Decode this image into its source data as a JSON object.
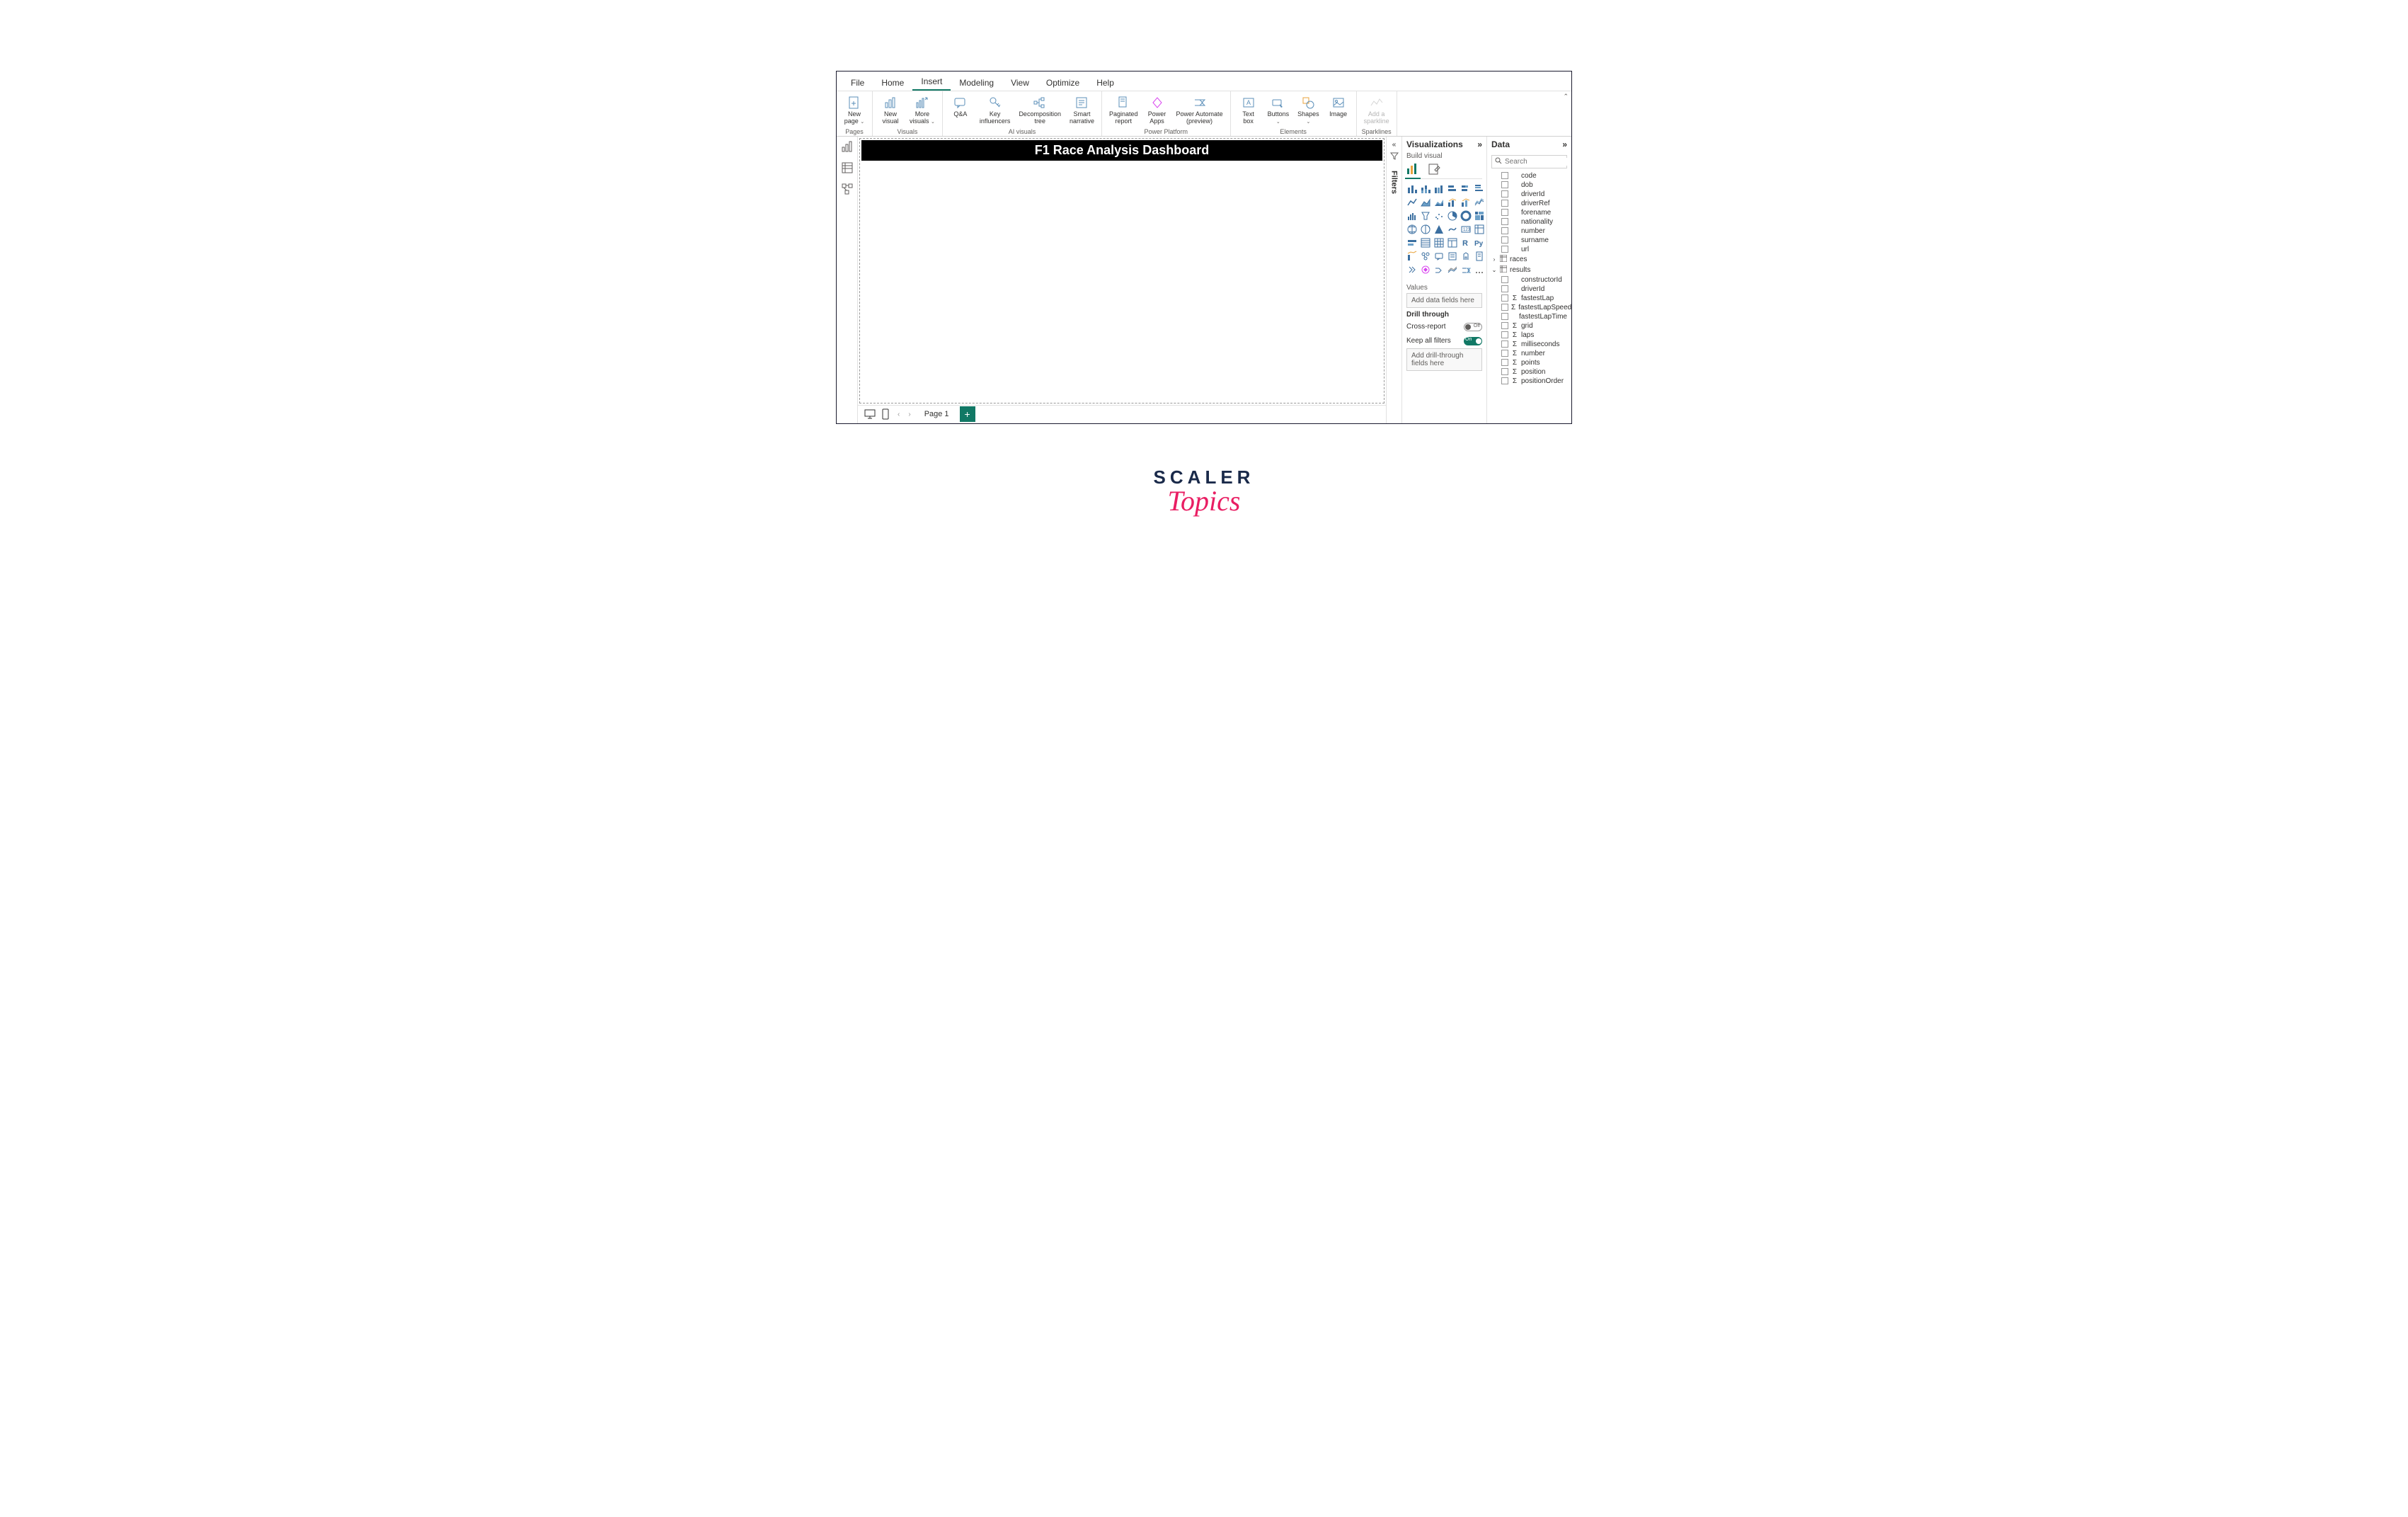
{
  "tabs": [
    "File",
    "Home",
    "Insert",
    "Modeling",
    "View",
    "Optimize",
    "Help"
  ],
  "activeTab": "Insert",
  "ribbon": {
    "pages": {
      "label": "Pages",
      "btns": [
        {
          "l1": "New",
          "l2": "page"
        }
      ]
    },
    "visuals": {
      "label": "Visuals",
      "btns": [
        {
          "l1": "New",
          "l2": "visual"
        },
        {
          "l1": "More",
          "l2": "visuals"
        }
      ]
    },
    "ai": {
      "label": "AI visuals",
      "btns": [
        {
          "l1": "Q&A",
          "l2": ""
        },
        {
          "l1": "Key",
          "l2": "influencers"
        },
        {
          "l1": "Decomposition",
          "l2": "tree"
        },
        {
          "l1": "Smart",
          "l2": "narrative"
        }
      ]
    },
    "pp": {
      "label": "Power Platform",
      "btns": [
        {
          "l1": "Paginated",
          "l2": "report"
        },
        {
          "l1": "Power",
          "l2": "Apps"
        },
        {
          "l1": "Power Automate",
          "l2": "(preview)"
        }
      ]
    },
    "elements": {
      "label": "Elements",
      "btns": [
        {
          "l1": "Text",
          "l2": "box"
        },
        {
          "l1": "Buttons",
          "l2": ""
        },
        {
          "l1": "Shapes",
          "l2": ""
        },
        {
          "l1": "Image",
          "l2": ""
        }
      ]
    },
    "sparklines": {
      "label": "Sparklines",
      "btns": [
        {
          "l1": "Add a",
          "l2": "sparkline"
        }
      ]
    }
  },
  "canvas": {
    "title": "F1 Race Analysis Dashboard"
  },
  "pageBar": {
    "page": "Page 1"
  },
  "filters": {
    "label": "Filters"
  },
  "viz": {
    "title": "Visualizations",
    "sub": "Build visual",
    "valuesLabel": "Values",
    "valuesWell": "Add data fields here",
    "drillLabel": "Drill through",
    "crossReport": "Cross-report",
    "crossReportState": "Off",
    "keepFilters": "Keep all filters",
    "keepFiltersState": "On",
    "drillWell": "Add drill-through fields here"
  },
  "data": {
    "title": "Data",
    "searchPlaceholder": "Search",
    "fieldsTop": [
      "code",
      "dob",
      "driverId",
      "driverRef",
      "forename",
      "nationality",
      "number",
      "surname",
      "url"
    ],
    "tables": [
      {
        "name": "races",
        "expanded": false
      },
      {
        "name": "results",
        "expanded": true
      }
    ],
    "resultsFields": [
      {
        "name": "constructorId",
        "sigma": false
      },
      {
        "name": "driverId",
        "sigma": false
      },
      {
        "name": "fastestLap",
        "sigma": true
      },
      {
        "name": "fastestLapSpeed",
        "sigma": true
      },
      {
        "name": "fastestLapTime",
        "sigma": false
      },
      {
        "name": "grid",
        "sigma": true
      },
      {
        "name": "laps",
        "sigma": true
      },
      {
        "name": "milliseconds",
        "sigma": true
      },
      {
        "name": "number",
        "sigma": true
      },
      {
        "name": "points",
        "sigma": true
      },
      {
        "name": "position",
        "sigma": true
      },
      {
        "name": "positionOrder",
        "sigma": true
      }
    ]
  },
  "logo": {
    "top": "SCALER",
    "bottom": "Topics"
  }
}
